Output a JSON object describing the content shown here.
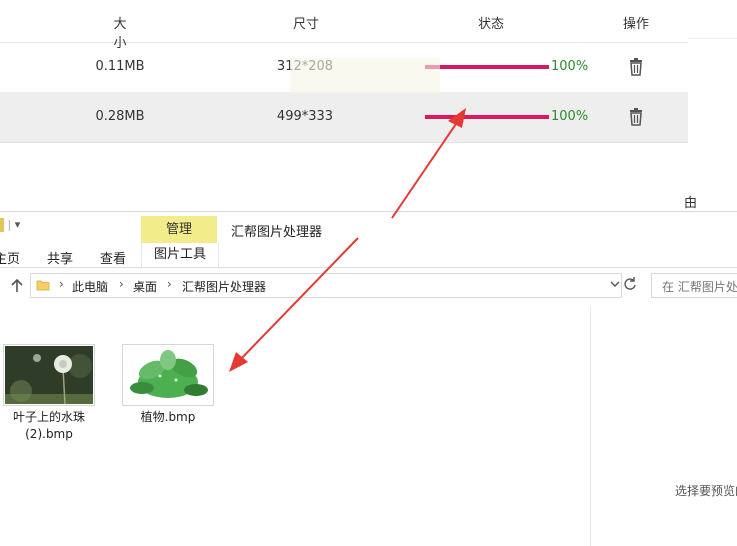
{
  "table": {
    "headers": {
      "size": "大小",
      "dimensions": "尺寸",
      "status": "状态",
      "actions": "操作"
    },
    "rows": [
      {
        "size": "0.11MB",
        "dimensions": "312*208",
        "progress": 1.0,
        "progress_label": "100%"
      },
      {
        "size": "0.28MB",
        "dimensions": "499*333",
        "progress": 1.0,
        "progress_label": "100%"
      }
    ]
  },
  "side_char": "甶",
  "explorer": {
    "qat_glyph": "▾",
    "context_tab_group": "管理",
    "window_title": "汇帮图片处理器",
    "ribbon_tabs": {
      "home": "主页",
      "share": "共享",
      "view": "查看",
      "picture_tools": "图片工具"
    },
    "breadcrumb": [
      "此电脑",
      "桌面",
      "汇帮图片处理器"
    ],
    "search_placeholder": "在 汇帮图片处",
    "preview_hint": "选择要预览的",
    "files": [
      {
        "name_line1": "叶子上的水珠",
        "name_line2": "(2).bmp"
      },
      {
        "name_line1": "植物.bmp",
        "name_line2": ""
      }
    ]
  },
  "colors": {
    "progress": "#d81b60",
    "percent_text": "#2e8b2e",
    "context_tab": "#f2ec8b",
    "arrow": "#e53935"
  }
}
